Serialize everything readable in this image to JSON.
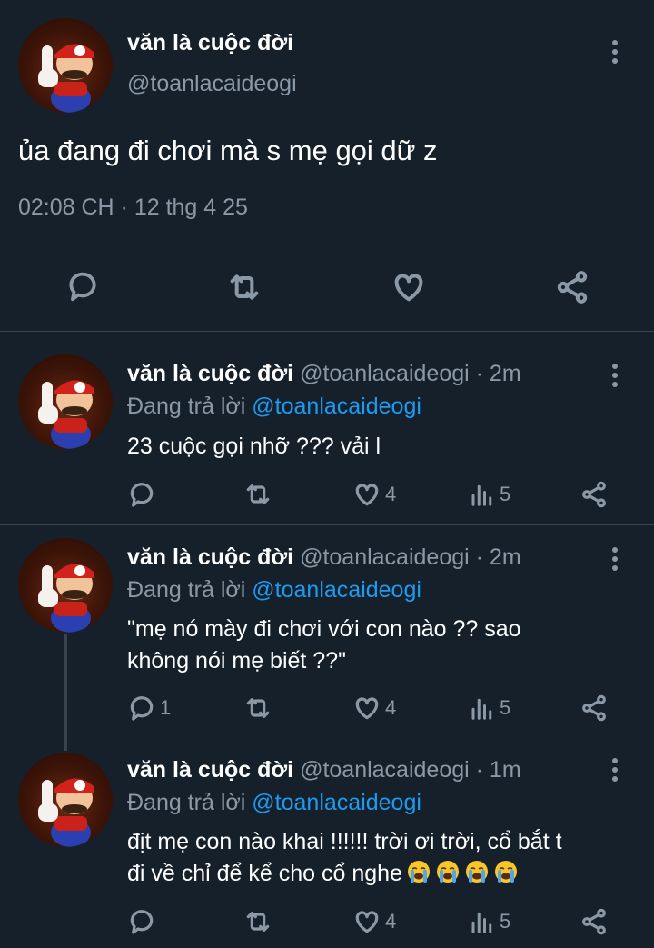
{
  "main_tweet": {
    "display_name": "văn là cuộc đời",
    "handle": "@toanlacaideogi",
    "text": "ủa đang đi chơi mà s mẹ gọi dữ z",
    "timestamp": "02:08 CH · 12 thg 4 25"
  },
  "replies": [
    {
      "display_name": "văn là cuộc đời",
      "handle": "@toanlacaideogi",
      "time": "· 2m",
      "replying_prefix": "Đang trả lời",
      "replying_handle": "@toanlacaideogi",
      "text_lines": [
        "23 cuộc gọi nhỡ ??? vải l"
      ],
      "reply_count": "",
      "like_count": "4",
      "view_count": "5"
    },
    {
      "display_name": "văn là cuộc đời",
      "handle": "@toanlacaideogi",
      "time": "· 2m",
      "replying_prefix": "Đang trả lời",
      "replying_handle": "@toanlacaideogi",
      "text_lines": [
        "\"mẹ nó mày đi chơi với con nào ?? sao",
        "không nói mẹ biết ??\""
      ],
      "reply_count": "1",
      "like_count": "4",
      "view_count": "5"
    },
    {
      "display_name": "văn là cuộc đời",
      "handle": "@toanlacaideogi",
      "time": "· 1m",
      "replying_prefix": "Đang trả lời",
      "replying_handle": "@toanlacaideogi",
      "text_lines": [
        "địt mẹ con nào khai !!!!!! trời ơi trời, cổ bắt t",
        "đi về chỉ để kể cho cổ nghe"
      ],
      "emoji": "loudly-crying-face",
      "emoji_count": 4,
      "reply_count": "",
      "like_count": "4",
      "view_count": "5"
    }
  ],
  "colors": {
    "background": "#15202b",
    "text": "#ffffff",
    "muted": "#8b98a5",
    "link": "#1d9bf0",
    "divider": "#38444d"
  }
}
